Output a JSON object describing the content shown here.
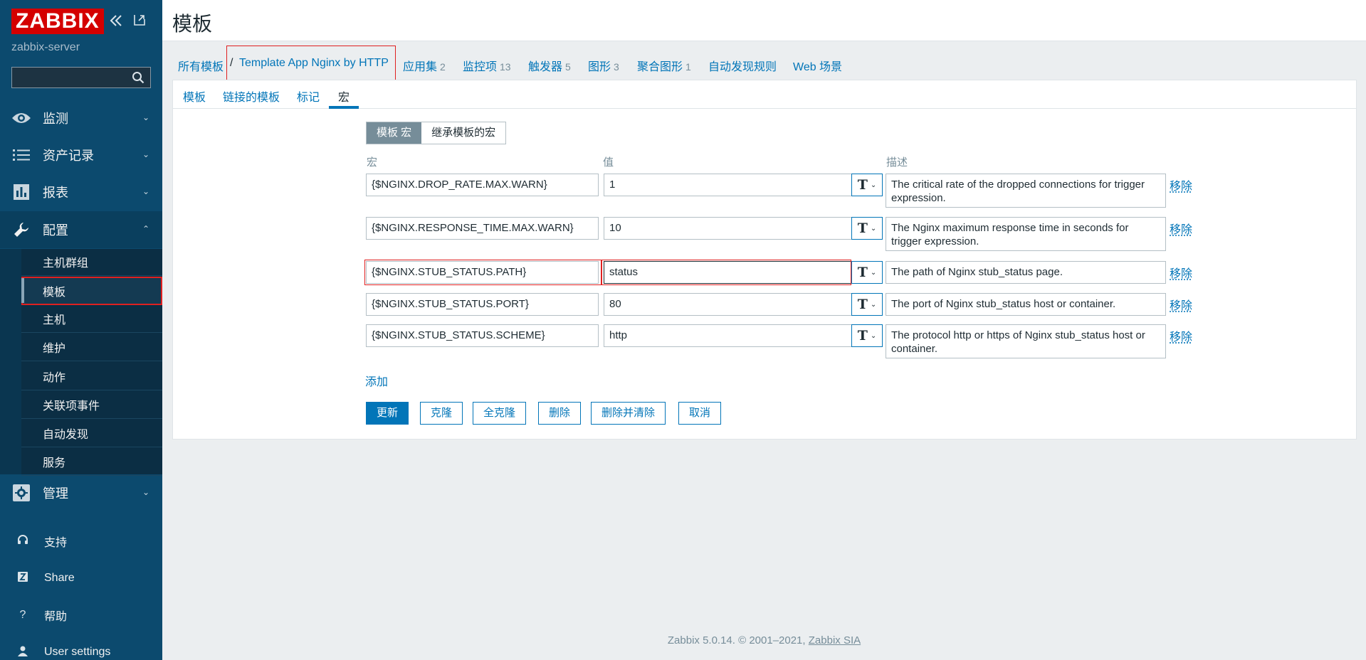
{
  "sidebar": {
    "logo": "ZABBIX",
    "server_name": "zabbix-server",
    "search_placeholder": "",
    "menu": [
      {
        "label": "监测",
        "icon": "eye-icon"
      },
      {
        "label": "资产记录",
        "icon": "list-icon"
      },
      {
        "label": "报表",
        "icon": "bar-chart-icon"
      },
      {
        "label": "配置",
        "icon": "wrench-icon"
      },
      {
        "label": "管理",
        "icon": "gear-icon"
      }
    ],
    "submenu": [
      "主机群组",
      "模板",
      "主机",
      "维护",
      "动作",
      "关联项事件",
      "自动发现",
      "服务"
    ],
    "bottom": [
      {
        "label": "支持",
        "icon": "headset-icon"
      },
      {
        "label": "Share",
        "icon": "share-icon"
      },
      {
        "label": "帮助",
        "icon": "help-icon"
      },
      {
        "label": "User settings",
        "icon": "user-icon"
      }
    ]
  },
  "header": {
    "title": "模板"
  },
  "breadcrumb": {
    "all_templates": "所有模板",
    "separator": "/",
    "current": "Template App Nginx by HTTP",
    "items": [
      {
        "label": "应用集",
        "count": "2"
      },
      {
        "label": "监控项",
        "count": "13"
      },
      {
        "label": "触发器",
        "count": "5"
      },
      {
        "label": "图形",
        "count": "3"
      },
      {
        "label": "聚合图形",
        "count": "1"
      },
      {
        "label": "自动发现规则",
        "count": ""
      },
      {
        "label": "Web 场景",
        "count": ""
      }
    ]
  },
  "tabs": [
    "模板",
    "链接的模板",
    "标记",
    "宏"
  ],
  "macro_mode": {
    "template": "模板 宏",
    "inherited": "继承模板的宏"
  },
  "columns": {
    "macro": "宏",
    "value": "值",
    "description": "描述"
  },
  "macros": [
    {
      "macro": "{$NGINX.DROP_RATE.MAX.WARN}",
      "value": "1",
      "description": "The critical rate of the dropped connections for trigger expression.",
      "remove": "移除"
    },
    {
      "macro": "{$NGINX.RESPONSE_TIME.MAX.WARN}",
      "value": "10",
      "description": "The Nginx maximum response time in seconds for trigger expression.",
      "remove": "移除"
    },
    {
      "macro": "{$NGINX.STUB_STATUS.PATH}",
      "value": "status",
      "description": "The path of Nginx stub_status page.",
      "remove": "移除"
    },
    {
      "macro": "{$NGINX.STUB_STATUS.PORT}",
      "value": "80",
      "description": "The port of Nginx stub_status host or container.",
      "remove": "移除"
    },
    {
      "macro": "{$NGINX.STUB_STATUS.SCHEME}",
      "value": "http",
      "description": "The protocol http or https of Nginx stub_status host or container.",
      "remove": "移除"
    }
  ],
  "add_label": "添加",
  "buttons": {
    "update": "更新",
    "clone": "克隆",
    "full_clone": "全克隆",
    "delete": "删除",
    "delete_clear": "删除并清除",
    "cancel": "取消"
  },
  "footer": {
    "text": "Zabbix 5.0.14. © 2001–2021, ",
    "company": "Zabbix SIA"
  }
}
